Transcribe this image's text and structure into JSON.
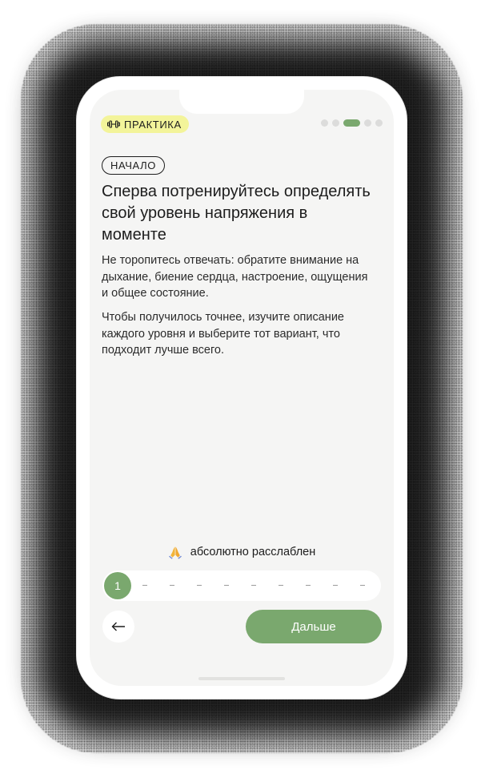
{
  "header": {
    "practice_tag": "ПРАКТИКА",
    "practice_icon": "dumbbell-icon",
    "progress": {
      "total_steps": 5,
      "current_step": 3
    }
  },
  "content": {
    "step_chip": "НАЧАЛО",
    "title": "Сперва потренируйтесь определять свой уровень напряжения в моменте",
    "paragraph_1": "Не торопитесь отвечать: обратите внимание на дыхание, биение сердца, настроение, ощущения и общее состояние.",
    "paragraph_2": "Чтобы получилось точнее, изучите описание каждого уровня и выберите тот вариант, что подходит лучше всего."
  },
  "level": {
    "icon": "folded-hands-icon",
    "label": "абсолютно расслаблен",
    "selected_value": "1",
    "scale_ticks": 9
  },
  "footer": {
    "back_icon": "arrow-left-icon",
    "next_label": "Дальше"
  },
  "colors": {
    "accent": "#7aa86e",
    "tag_bg": "#f3f49a",
    "screen_bg": "#f5f5f4"
  }
}
